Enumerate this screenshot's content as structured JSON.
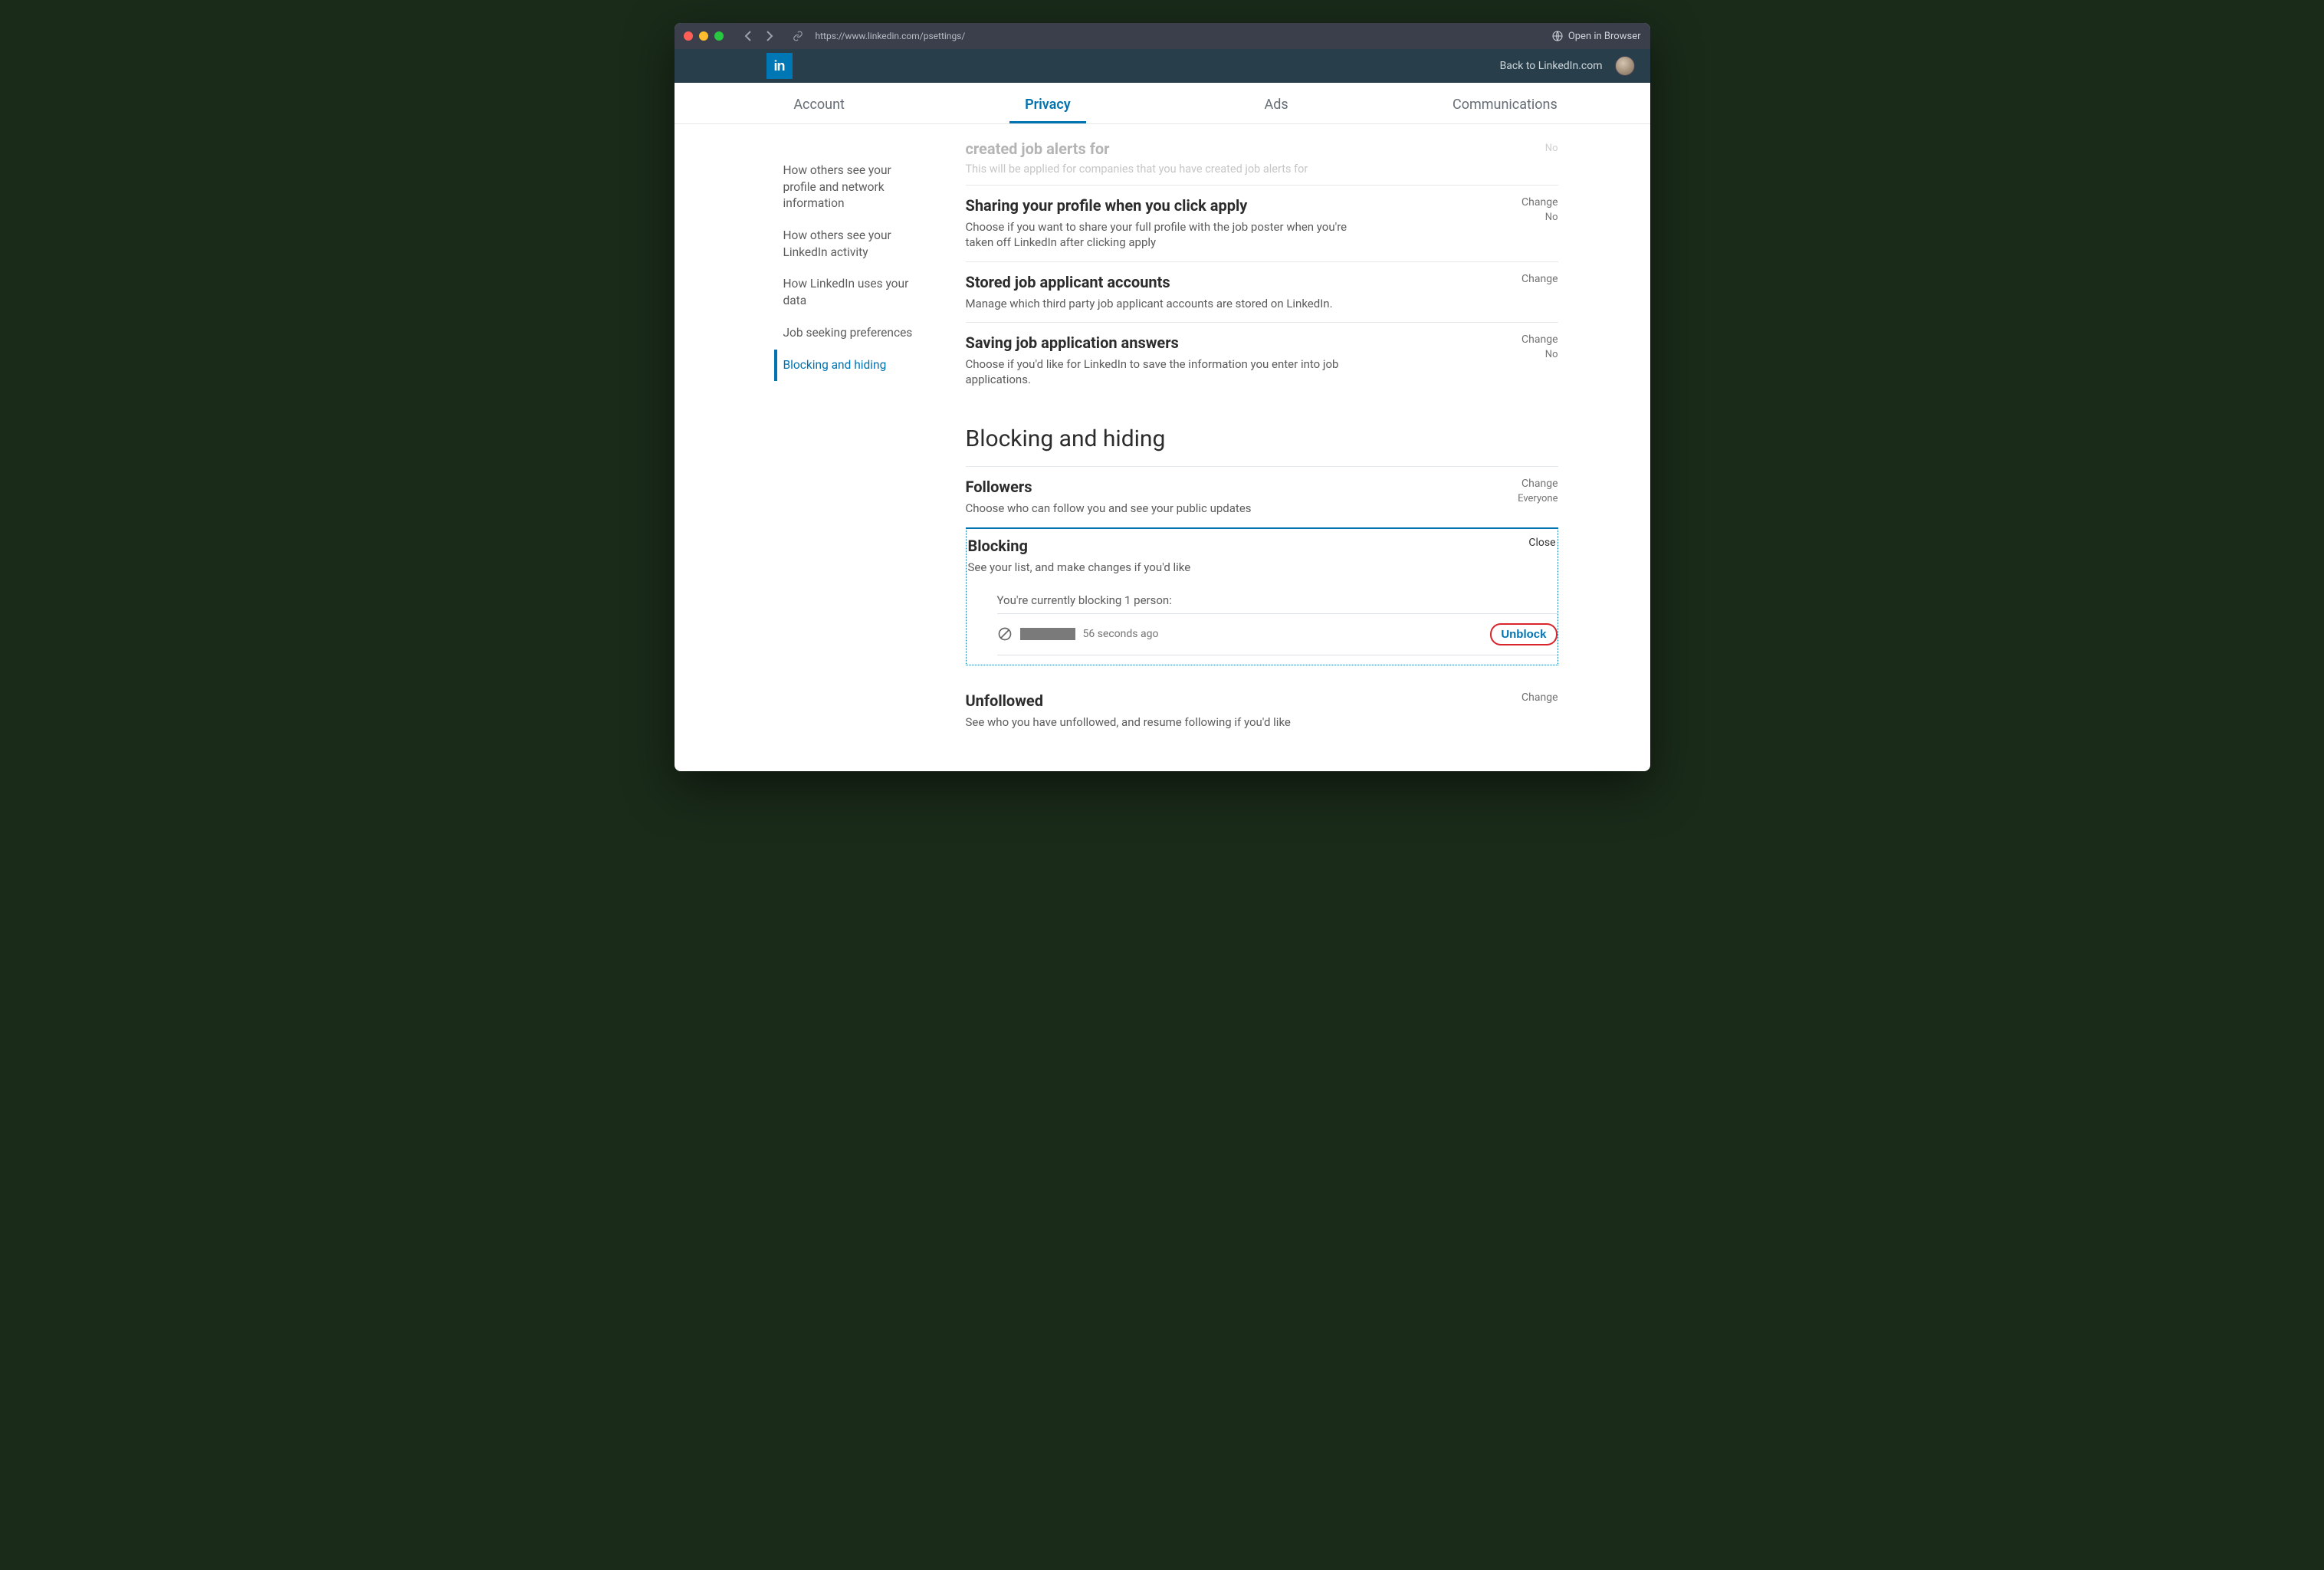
{
  "titlebar": {
    "url": "https://www.linkedin.com/psettings/",
    "open_browser": "Open in Browser"
  },
  "header": {
    "logo_text": "in",
    "back_link": "Back to LinkedIn.com"
  },
  "tabs": [
    {
      "label": "Account",
      "active": false
    },
    {
      "label": "Privacy",
      "active": true
    },
    {
      "label": "Ads",
      "active": false
    },
    {
      "label": "Communications",
      "active": false
    }
  ],
  "sidebar": {
    "items": [
      {
        "label": "How others see your profile and network information",
        "active": false
      },
      {
        "label": "How others see your LinkedIn activity",
        "active": false
      },
      {
        "label": "How LinkedIn uses your data",
        "active": false
      },
      {
        "label": "Job seeking preferences",
        "active": false
      },
      {
        "label": "Blocking and hiding",
        "active": true
      }
    ]
  },
  "faded": {
    "title": "created job alerts for",
    "desc": "This will be applied for companies that you have created job alerts for",
    "value": "No"
  },
  "settings": [
    {
      "title": "Sharing your profile when you click apply",
      "desc": "Choose if you want to share your full profile with the job poster when you're taken off LinkedIn after clicking apply",
      "action": "Change",
      "value": "No"
    },
    {
      "title": "Stored job applicant accounts",
      "desc": "Manage which third party job applicant accounts are stored on LinkedIn.",
      "action": "Change",
      "value": ""
    },
    {
      "title": "Saving job application answers",
      "desc": "Choose if you'd like for LinkedIn to save the information you enter into job applications.",
      "action": "Change",
      "value": "No"
    }
  ],
  "section_heading": "Blocking and hiding",
  "followers": {
    "title": "Followers",
    "desc": "Choose who can follow you and see your public updates",
    "action": "Change",
    "value": "Everyone"
  },
  "blocking": {
    "title": "Blocking",
    "desc": "See your list, and make changes if you'd like",
    "close": "Close",
    "list_label": "You're currently blocking 1 person:",
    "time": "56 seconds ago",
    "unblock": "Unblock"
  },
  "unfollowed": {
    "title": "Unfollowed",
    "desc": "See who you have unfollowed, and resume following if you'd like",
    "action": "Change"
  }
}
